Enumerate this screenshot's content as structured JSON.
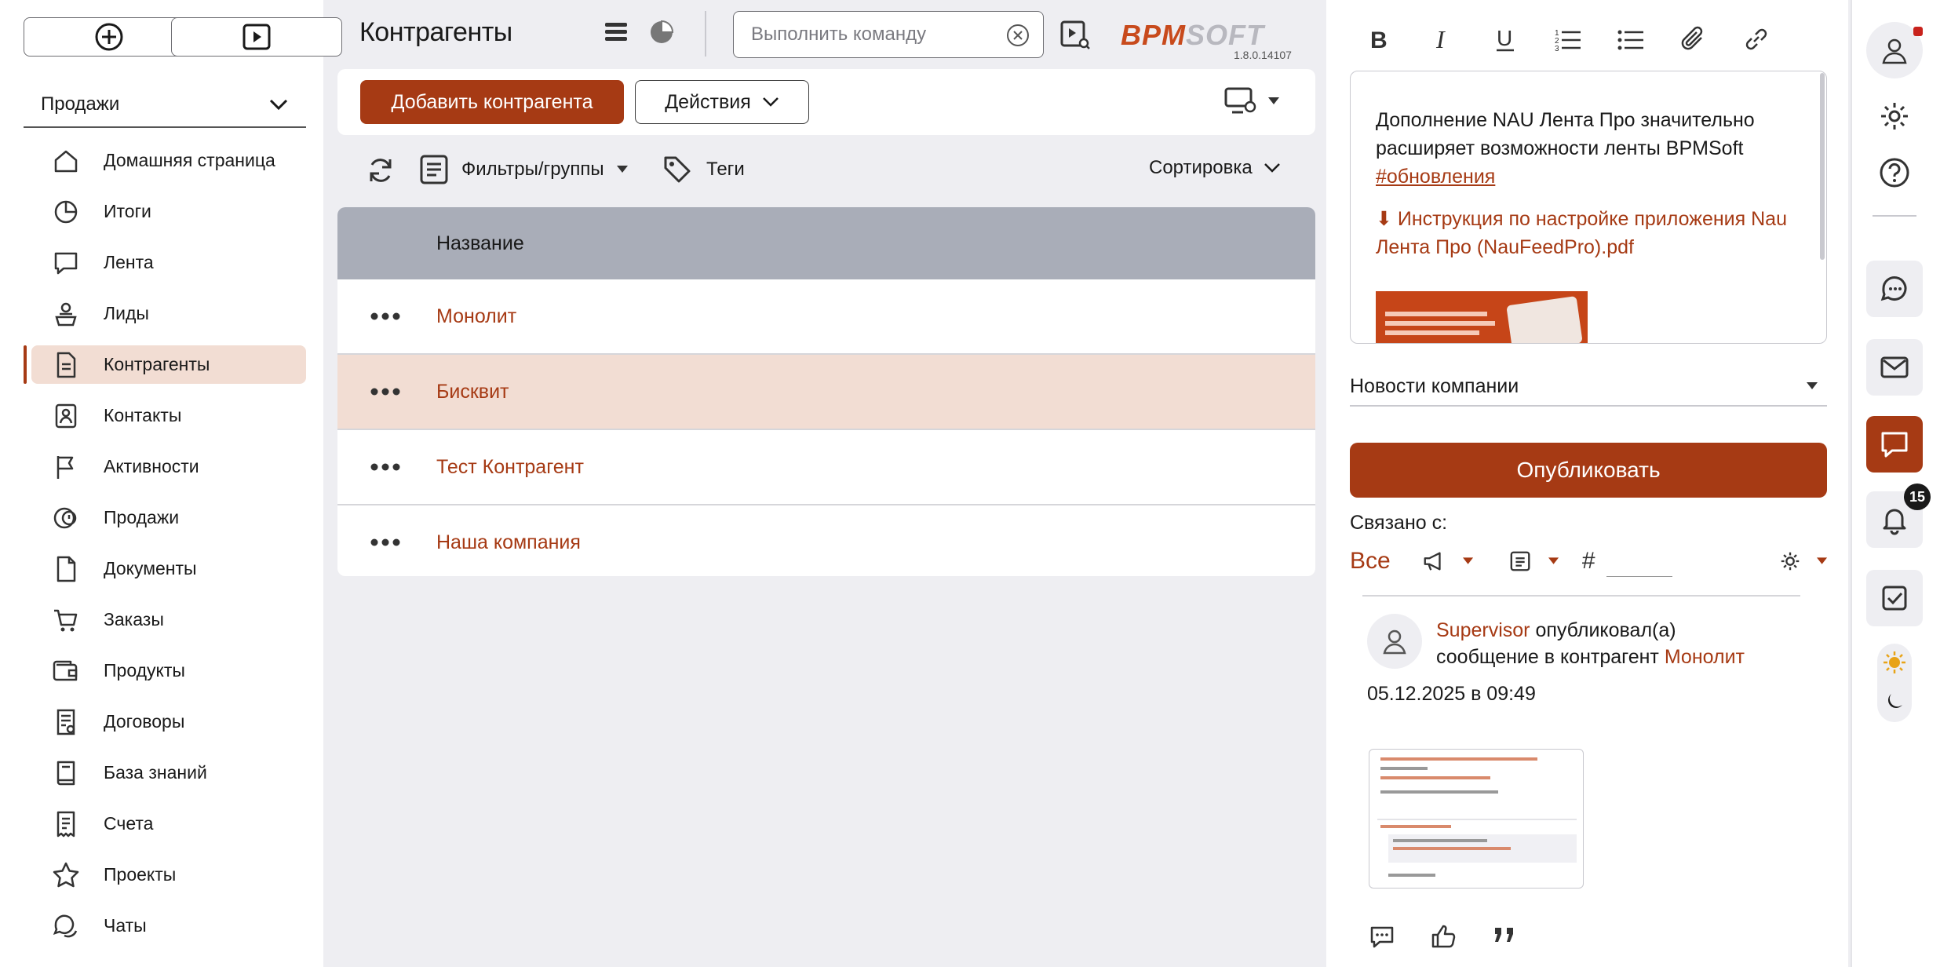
{
  "brand": {
    "logo_left": "BPM",
    "logo_right": "SOFT",
    "version": "1.8.0.14107",
    "accent": "#a63a14"
  },
  "sidebar": {
    "section": "Продажи",
    "items": [
      {
        "label": "Домашняя страница",
        "icon": "home-icon"
      },
      {
        "label": "Итоги",
        "icon": "pie-chart-icon"
      },
      {
        "label": "Лента",
        "icon": "chat-bubble-icon"
      },
      {
        "label": "Лиды",
        "icon": "lead-icon"
      },
      {
        "label": "Контрагенты",
        "icon": "document-icon",
        "active": true
      },
      {
        "label": "Контакты",
        "icon": "contact-icon"
      },
      {
        "label": "Активности",
        "icon": "flag-icon"
      },
      {
        "label": "Продажи",
        "icon": "sales-icon"
      },
      {
        "label": "Документы",
        "icon": "file-icon"
      },
      {
        "label": "Заказы",
        "icon": "cart-icon"
      },
      {
        "label": "Продукты",
        "icon": "wallet-icon"
      },
      {
        "label": "Договоры",
        "icon": "contract-icon"
      },
      {
        "label": "База знаний",
        "icon": "book-icon"
      },
      {
        "label": "Счета",
        "icon": "invoice-icon"
      },
      {
        "label": "Проекты",
        "icon": "star-icon"
      },
      {
        "label": "Чаты",
        "icon": "chats-icon"
      }
    ]
  },
  "header": {
    "title": "Контрагенты",
    "command_placeholder": "Выполнить команду"
  },
  "toolbar": {
    "add_label": "Добавить контрагента",
    "actions_label": "Действия"
  },
  "filters": {
    "filters_label": "Фильтры/группы",
    "tags_label": "Теги",
    "sort_label": "Сортировка"
  },
  "table": {
    "column_header": "Название",
    "rows": [
      "Монолит",
      "Бисквит",
      "Тест Контрагент",
      "Наша компания"
    ],
    "selected_index": 1
  },
  "feed": {
    "editor_text": "Дополнение NAU Лента Про значительно расширяет возможности ленты BPMSoft",
    "editor_hashtag": "#обновления",
    "attachment_text": "⬇ Инструкция по настройке приложения Nau Лента Про (NauFeedPro).pdf",
    "channel": "Новости компании",
    "publish_label": "Опубликовать",
    "related_label": "Связано с:",
    "all_label": "Все",
    "hash_label": "#",
    "post": {
      "author": "Supervisor",
      "action": "опубликовал(а)",
      "action2": "сообщение в контрагент",
      "target": "Монолит",
      "date": "05.12.2025 в 09:49"
    }
  },
  "rail": {
    "notifications_count": "15"
  }
}
